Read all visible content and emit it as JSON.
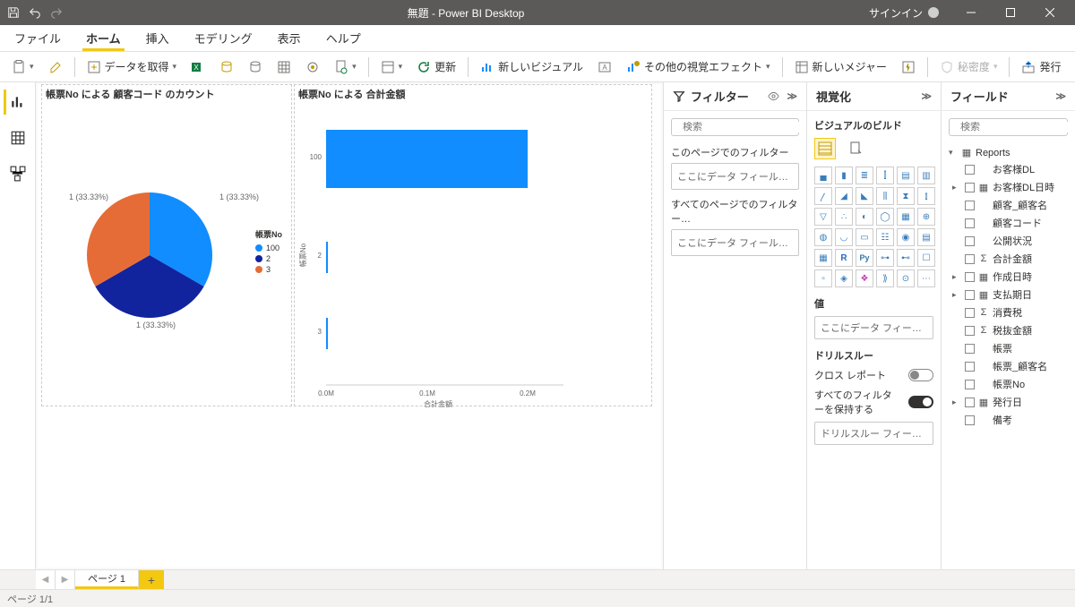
{
  "titlebar": {
    "title": "無題 - Power BI Desktop",
    "signin": "サインイン"
  },
  "menu": {
    "file": "ファイル",
    "home": "ホーム",
    "insert": "挿入",
    "modeling": "モデリング",
    "view": "表示",
    "help": "ヘルプ"
  },
  "ribbon": {
    "get_data": "データを取得",
    "refresh": "更新",
    "new_visual": "新しいビジュアル",
    "more_visual": "その他の視覚エフェクト",
    "new_measure": "新しいメジャー",
    "sensitivity": "秘密度",
    "publish": "発行"
  },
  "filters": {
    "header": "フィルター",
    "search_ph": "検索",
    "page_section": "このページでのフィルター",
    "allpages_section": "すべてのページでのフィルター…",
    "drop_text": "ここにデータ フィールド..."
  },
  "viz": {
    "header": "視覚化",
    "build": "ビジュアルのビルド",
    "value": "値",
    "value_drop": "ここにデータ フィールド...",
    "drill": "ドリルスルー",
    "cross": "クロス レポート",
    "keep": "すべてのフィルターを保持する",
    "drill_drop": "ドリルスルー フィールド..."
  },
  "fields": {
    "header": "フィールド",
    "search_ph": "検索",
    "table": "Reports",
    "items": [
      "お客様DL",
      "お客様DL日時",
      "顧客_顧客名",
      "顧客コード",
      "公開状況",
      "合計金額",
      "作成日時",
      "支払期日",
      "消費税",
      "税抜金額",
      "帳票",
      "帳票_顧客名",
      "帳票No",
      "発行日",
      "備考"
    ]
  },
  "charts": {
    "pie_title": "帳票No による 顧客コード のカウント",
    "bar_title": "帳票No による 合計金額",
    "pie_legend_title": "帳票No",
    "pie_legend": [
      "100",
      "2",
      "3"
    ],
    "pie_labels": [
      "1 (33.33%)",
      "1 (33.33%)",
      "1 (33.33%)"
    ],
    "bar_ylabel": "帳票No",
    "bar_xlabel": "合計金額",
    "bar_xticks": [
      "0.0M",
      "0.1M",
      "0.2M"
    ],
    "bar_cats": [
      "100",
      "2",
      "3"
    ]
  },
  "pages": {
    "p1": "ページ 1"
  },
  "status": "ページ 1/1",
  "chart_data": [
    {
      "type": "pie",
      "title": "帳票No による 顧客コード のカウント",
      "categories": [
        "100",
        "2",
        "3"
      ],
      "values": [
        1,
        1,
        1
      ],
      "labels": [
        "1 (33.33%)",
        "1 (33.33%)",
        "1 (33.33%)"
      ],
      "colors": [
        "#118dff",
        "#12239e",
        "#e66c37"
      ]
    },
    {
      "type": "bar",
      "orientation": "horizontal",
      "title": "帳票No による 合計金額",
      "xlabel": "合計金額",
      "ylabel": "帳票No",
      "categories": [
        "100",
        "2",
        "3"
      ],
      "values": [
        200000,
        1000,
        1000
      ],
      "xlim": [
        0,
        250000
      ],
      "xticks_display": [
        "0.0M",
        "0.1M",
        "0.2M"
      ]
    }
  ]
}
